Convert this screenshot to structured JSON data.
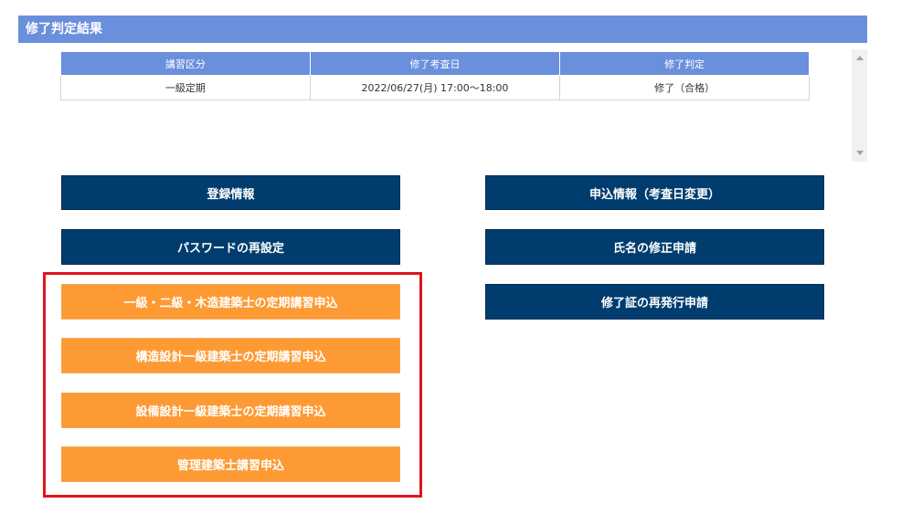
{
  "section": {
    "title": "修了判定結果"
  },
  "result_table": {
    "headers": [
      "講習区分",
      "修了考査日",
      "修了判定"
    ],
    "rows": [
      [
        "一級定期",
        "2022/06/27(月) 17:00～18:00",
        "修了（合格）"
      ]
    ]
  },
  "buttons": {
    "registration": "登録情報",
    "application_info": "申込情報（考査日変更）",
    "password_reset": "パスワードの再設定",
    "name_correction": "氏名の修正申請",
    "certificate_reissue": "修了証の再発行申請",
    "regular_course": "一級・二級・木造建築士の定期講習申込",
    "structural_course": "構造設計一級建築士の定期講習申込",
    "equipment_course": "設備設計一級建築士の定期講習申込",
    "management_course": "管理建築士講習申込"
  },
  "colors": {
    "header_bg": "#6a8fdc",
    "navy_button": "#003d6e",
    "orange_button": "#fd9a33",
    "highlight_border": "#e0141e"
  }
}
